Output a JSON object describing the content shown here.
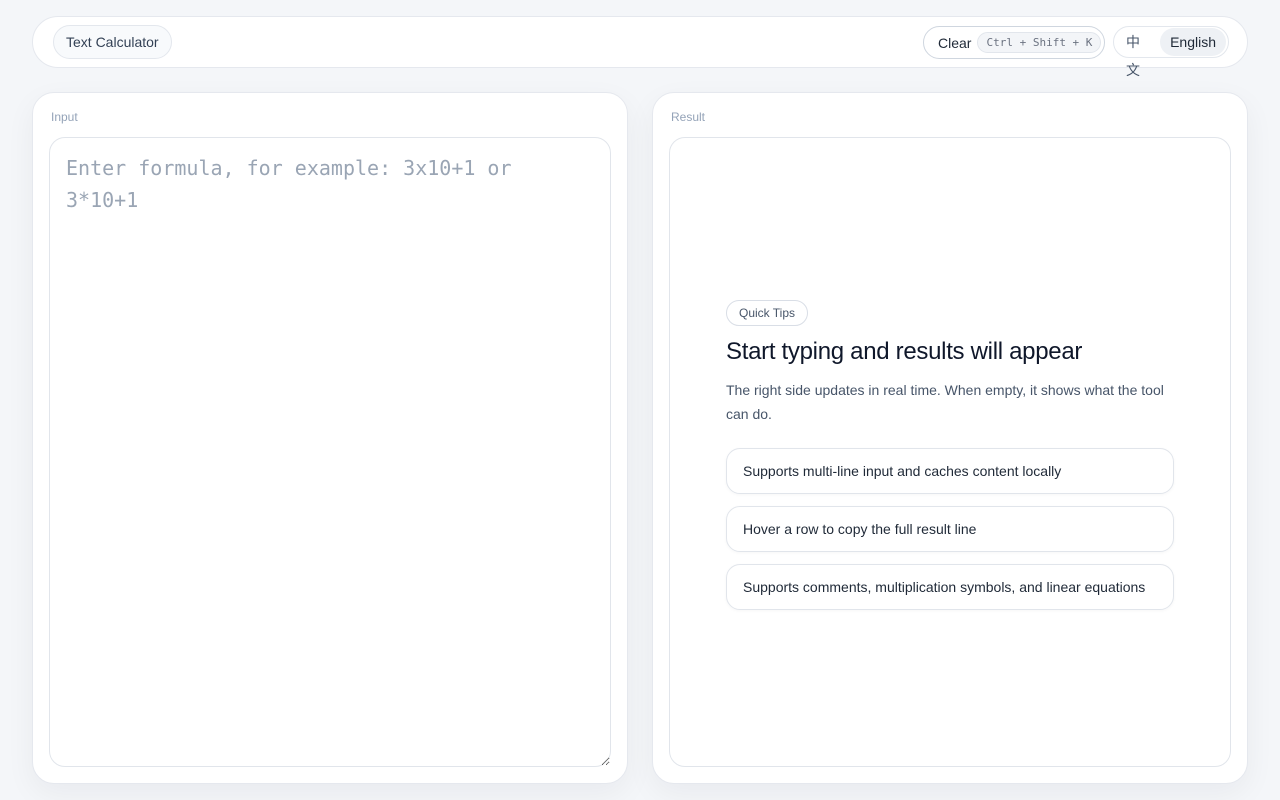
{
  "header": {
    "app_title": "Text Calculator",
    "clear_label": "Clear",
    "clear_shortcut": "Ctrl + Shift + K",
    "languages": [
      {
        "label": "中文",
        "active": false
      },
      {
        "label": "English",
        "active": true
      }
    ]
  },
  "input_panel": {
    "label": "Input",
    "placeholder": "Enter formula, for example: 3x10+1 or 3*10+1",
    "value": ""
  },
  "result_panel": {
    "label": "Result",
    "tips": {
      "badge": "Quick Tips",
      "heading": "Start typing and results will appear",
      "description": "The right side updates in real time. When empty, it shows what the tool can do.",
      "items": [
        "Supports multi-line input and caches content locally",
        "Hover a row to copy the full result line",
        "Supports comments, multiplication symbols, and linear equations"
      ]
    }
  }
}
